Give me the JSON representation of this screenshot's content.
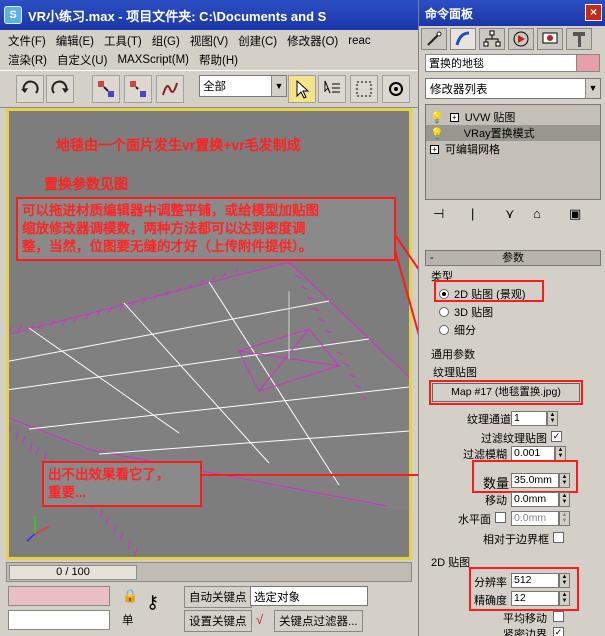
{
  "window": {
    "title": "VR小练习.max   - 项目文件夹: C:\\Documents and S"
  },
  "menu_row1": [
    "文件(F)",
    "编辑(E)",
    "工具(T)",
    "组(G)",
    "视图(V)",
    "创建(C)",
    "修改器(O)",
    "reac"
  ],
  "menu_row2": [
    "渲染(R)",
    "自定义(U)",
    "MAXScript(M)",
    "帮助(H)"
  ],
  "toolbar": {
    "selection_filter": "全部"
  },
  "icons": [
    "undo-icon",
    "redo-icon",
    "link-icon",
    "unlink-icon",
    "bind-icon",
    "select-icon",
    "select-by-name-icon",
    "rect-region-icon",
    "window-crossing-icon"
  ],
  "viewport": {
    "note_line1": "地毯由一个面片发生vr置换+vr毛发制成",
    "note_line2": "置换参数见图",
    "box1_lines": [
      "可以拖进材质编辑器中调整平铺，或给模型加贴图",
      "缩放修改器调模数，两种方法都可以达到密度调",
      "整，当然，位图要无缝的才好（上传附件提供）。"
    ],
    "box2_lines": [
      "出不出效果看它了，",
      "重要..."
    ]
  },
  "timeline": {
    "frame": "0 / 100"
  },
  "status": {
    "auto_key": "自动关键点",
    "set_key": "设置关键点",
    "selected": "选定对象",
    "key_filter": "关键点过滤器...",
    "single": "单"
  },
  "command_panel": {
    "title": "命令面板",
    "object_name": "置换的地毯",
    "object_color": "#e8a0a8",
    "modifier_list": "修改器列表",
    "stack": [
      {
        "label": "UVW 贴图",
        "selected": false
      },
      {
        "label": "VRay置换模式",
        "selected": true
      },
      {
        "label": "可编辑网格",
        "selected": false
      }
    ],
    "rollout_title": "参数",
    "type_group": "类型",
    "type_options": [
      "2D 贴图 (景观)",
      "3D 贴图",
      "细分"
    ],
    "common_group": "通用参数",
    "texmap_label": "纹理贴图",
    "map_button": "Map #17 (地毯置换.jpg)",
    "fields": [
      {
        "label": "纹理通道",
        "value": "1"
      },
      {
        "label": "过滤纹理贴图",
        "value": ""
      },
      {
        "label": "过滤模糊",
        "value": "0.001"
      },
      {
        "label": "数量",
        "value": "35.0mm"
      },
      {
        "label": "移动",
        "value": "0.0mm"
      },
      {
        "label": "水平面",
        "value": "0.0mm"
      },
      {
        "label": "相对于边界框",
        "value": ""
      }
    ],
    "map2d_group": "2D 贴图",
    "resolution_label": "分辨率",
    "resolution_value": "512",
    "precision_label": "精确度",
    "precision_value": "12",
    "smooth_label": "平均移动",
    "edge_label": "紧密边界"
  },
  "colors": {
    "annotation_red": "#ff1a1a",
    "title_blue": "#2340b8",
    "fur_magenta": "#d030c8"
  }
}
